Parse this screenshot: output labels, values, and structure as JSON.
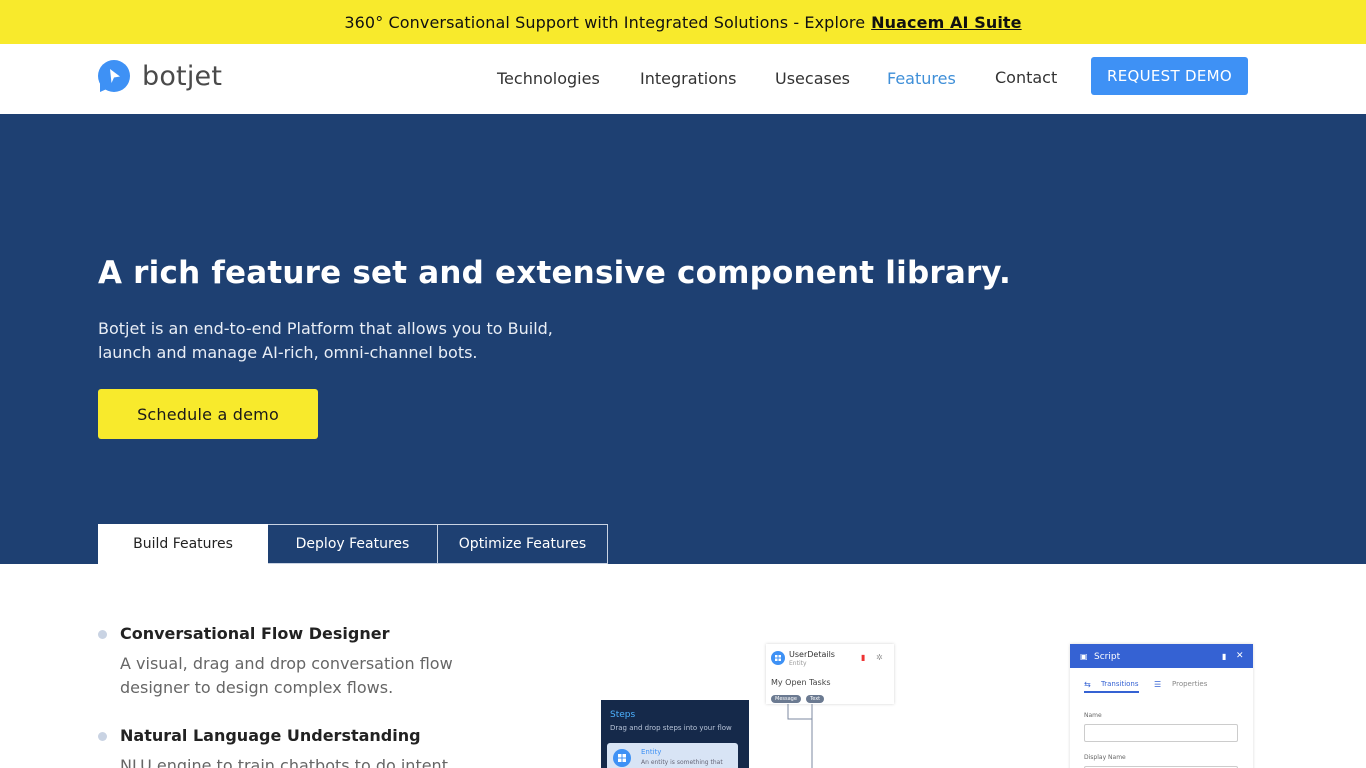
{
  "announcement": {
    "text": "360° Conversational Support with Integrated Solutions - Explore",
    "link_text": "Nuacem AI Suite"
  },
  "header": {
    "logo_text": "botjet",
    "nav": [
      {
        "label": "Technologies"
      },
      {
        "label": "Integrations"
      },
      {
        "label": "Usecases"
      },
      {
        "label": "Features",
        "active": true
      },
      {
        "label": "Contact"
      }
    ],
    "cta_label": "REQUEST DEMO"
  },
  "hero": {
    "title": "A rich feature set and extensive component library.",
    "description": "Botjet is an end-to-end Platform that allows you to Build, launch and manage AI-rich, omni-channel bots.",
    "cta_label": "Schedule a demo",
    "tabs": [
      {
        "label": "Build Features",
        "active": true
      },
      {
        "label": "Deploy Features"
      },
      {
        "label": "Optimize Features"
      }
    ]
  },
  "features": [
    {
      "title": "Conversational Flow Designer",
      "description": "A visual, drag and drop conversation flow designer to design complex flows."
    },
    {
      "title": "Natural Language Understanding",
      "description": "NLU engine to train chatbots to do intent"
    }
  ],
  "illustration": {
    "user_card": {
      "title": "UserDetails",
      "subtitle": "Entity",
      "task": "My Open Tasks",
      "chip1": "Message",
      "chip2": "Text"
    },
    "steps_panel": {
      "title": "Steps",
      "subtitle": "Drag and drop steps into your flow",
      "item_title": "Entity",
      "item_desc": "An entity is something that"
    },
    "script_panel": {
      "title": "Script",
      "tab1": "Transitions",
      "tab2": "Properties",
      "field1": "Name",
      "field2": "Display Name"
    }
  },
  "colors": {
    "announcement_bg": "#f8ea2c",
    "hero_bg": "#1e4072",
    "accent": "#3e91f5",
    "nav_active": "#3f8fd8"
  }
}
